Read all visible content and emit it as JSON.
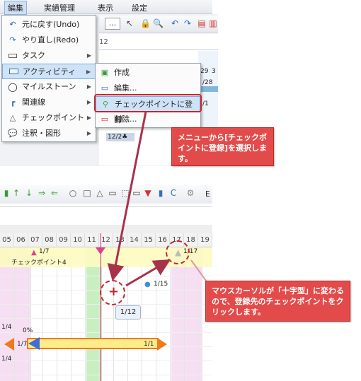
{
  "menubar": {
    "items": [
      "編集",
      "実績管理",
      "表示",
      "設定"
    ]
  },
  "toolbar_top": {
    "dots": "...",
    "date_fragment": "12",
    "row_dates": [
      "29",
      "3",
      "/28",
      "/1",
      "12/2♣"
    ]
  },
  "menu": {
    "items": [
      {
        "label": "元に戻す(Undo)",
        "icon": "undo-icon",
        "arrow": false
      },
      {
        "label": "やり直し(Redo)",
        "icon": "redo-icon",
        "arrow": false
      },
      {
        "label": "タスク",
        "icon": "task-icon",
        "arrow": true
      },
      {
        "label": "アクティビティ",
        "icon": "activity-icon",
        "arrow": true
      },
      {
        "label": "マイルストーン",
        "icon": "milestone-icon",
        "arrow": true
      },
      {
        "label": "関連線",
        "icon": "link-icon",
        "arrow": true
      },
      {
        "label": "チェックポイント",
        "icon": "checkpoint-icon",
        "arrow": true
      },
      {
        "label": "注釈・図形",
        "icon": "annotation-icon",
        "arrow": true
      }
    ]
  },
  "submenu": {
    "items": [
      {
        "label": "作成",
        "icon": "create-icon"
      },
      {
        "label": "編集...",
        "icon": "edit-icon"
      },
      {
        "label": "チェックポイントに登録...",
        "icon": "register-checkpoint-icon"
      },
      {
        "label": "削除...",
        "icon": "delete-icon"
      }
    ]
  },
  "callout1": {
    "text": "メニューから[チェックポイントに登録]を選択します。"
  },
  "callout2": {
    "text": "マウスカーソルが「十字型」に変わるので、登録先のチェックポイントをクリックします。"
  },
  "gantt": {
    "days": [
      "05",
      "06",
      "07",
      "08",
      "09",
      "10",
      "11",
      "12",
      "13",
      "14",
      "15",
      "16",
      "17",
      "18",
      "19"
    ],
    "checkpoint_label": "チェックポイント4",
    "marker_a": "1/7",
    "marker_b": "1/17",
    "dot_label": "1/15",
    "tooltip": "1/12",
    "left_labels": [
      "1/4",
      "0%",
      "1/7",
      "1/4"
    ],
    "bar_end": "1/1",
    "e_label": "E"
  },
  "colors": {
    "accent": "#e34b4b",
    "highlight": "#cfe3f8",
    "band_green": "#c9efc1",
    "band_pink": "#f6dff3",
    "milestone_band": "#fdfbc0"
  }
}
